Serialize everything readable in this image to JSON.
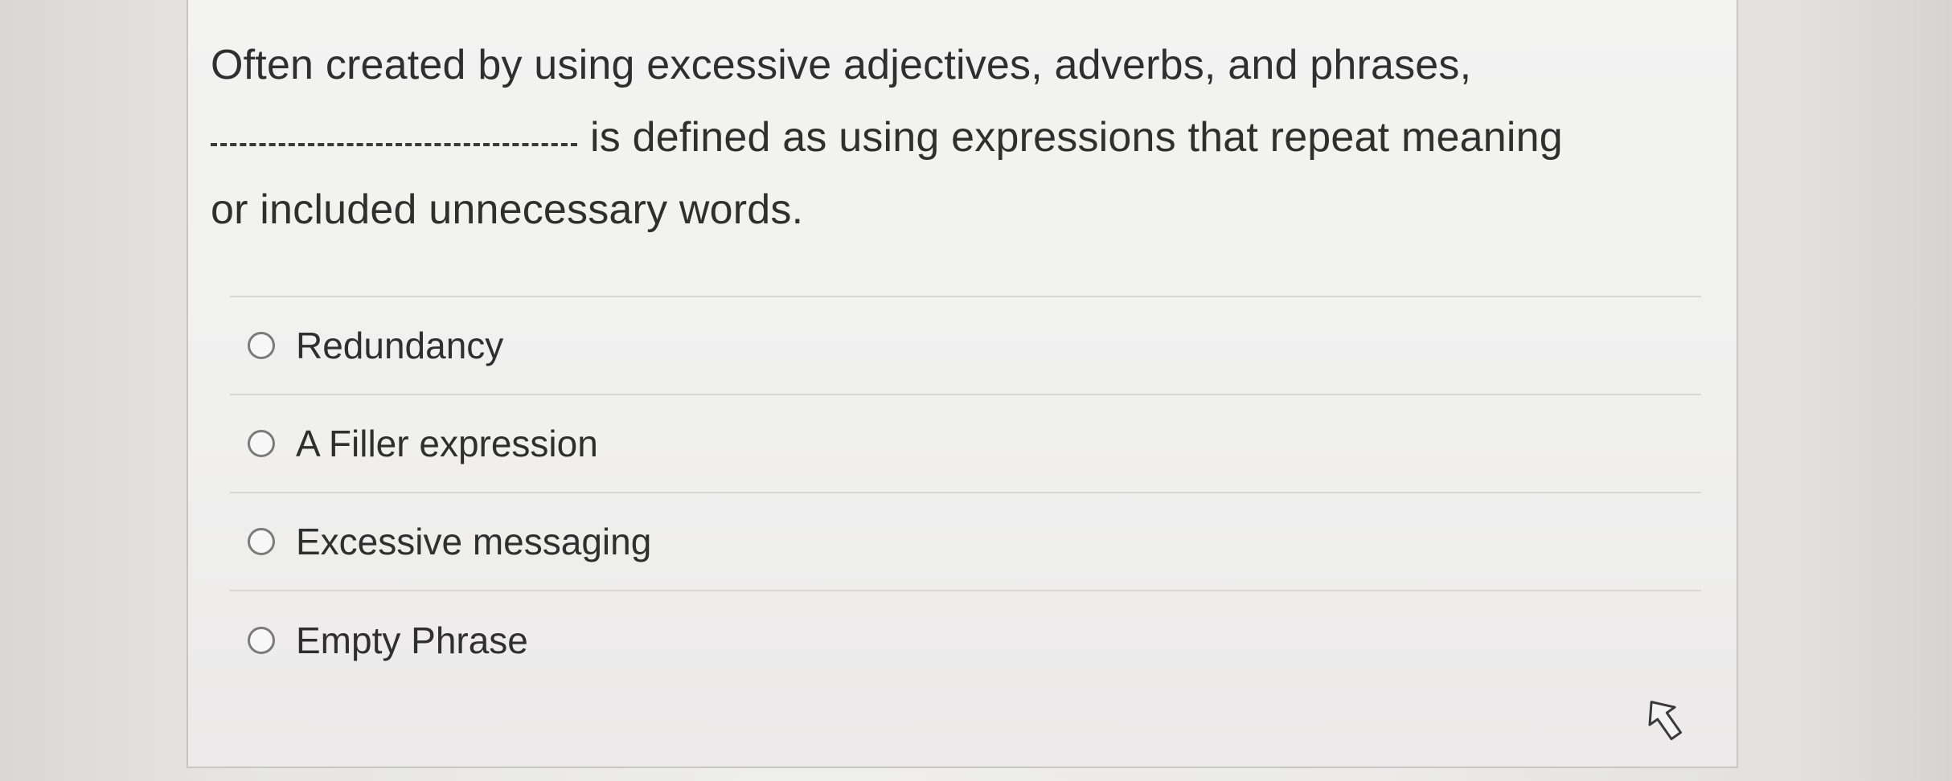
{
  "question": {
    "line1": "Often created by using excessive adjectives, adverbs, and phrases,",
    "line2": "is defined as using expressions that repeat meaning",
    "line3": "or included unnecessary words."
  },
  "options": [
    "Redundancy",
    "A Filler expression",
    "Excessive messaging",
    "Empty Phrase"
  ],
  "cursor_icon": "arrow-pointer-icon"
}
